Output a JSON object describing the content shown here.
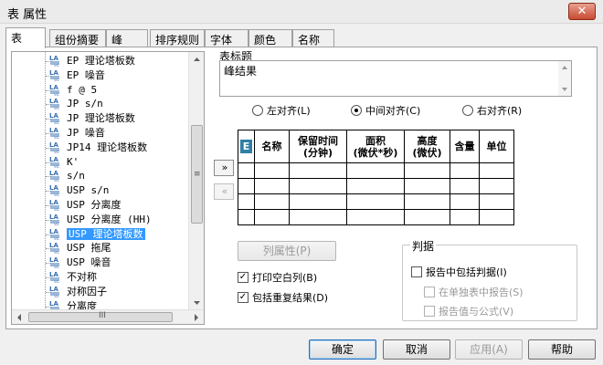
{
  "window": {
    "title": "表 属性",
    "close_glyph": "✕"
  },
  "tabs": [
    {
      "label": "表",
      "active": true
    },
    {
      "label": "组份摘要"
    },
    {
      "label": "峰"
    },
    {
      "label": "排序规则"
    },
    {
      "label": "字体"
    },
    {
      "label": "颜色"
    },
    {
      "label": "名称"
    }
  ],
  "tree": {
    "items": [
      "EP 理论塔板数",
      "EP 噪音",
      "f @ 5",
      "JP s/n",
      "JP 理论塔板数",
      "JP 噪音",
      "JP14 理论塔板数",
      "K'",
      "s/n",
      "USP s/n",
      "USP 分离度",
      "USP 分离度 (HH)",
      "USP 理论塔板数",
      "USP 拖尾",
      "USP 噪音",
      "不对称",
      "对称因子",
      "分离度"
    ],
    "selected_index": 12,
    "vscroll_grip": "≡",
    "hscroll_grip": "III"
  },
  "title_group": {
    "legend": "表标题",
    "value": "峰结果"
  },
  "alignment": {
    "options": [
      "左对齐(L)",
      "中间对齐(C)",
      "右对齐(R)"
    ],
    "selected_index": 1
  },
  "columns": {
    "icon": "E",
    "headers": [
      "名称",
      "保留时间\n(分钟)",
      "面积\n(微伏*秒)",
      "高度\n(微伏)",
      "含量",
      "单位"
    ],
    "empty_rows": 4
  },
  "move_buttons": {
    "add": "»",
    "remove": "«"
  },
  "column_properties_button": "列属性(P)",
  "options": {
    "print_empty_columns": {
      "label": "打印空白列(B)",
      "checked": true
    },
    "include_duplicate_results": {
      "label": "包括重复结果(D)",
      "checked": true
    }
  },
  "judgment": {
    "legend": "判据",
    "include": {
      "label": "报告中包括判据(I)",
      "checked": false
    },
    "separate_table": {
      "label": "在单独表中报告(S)",
      "checked": false
    },
    "report_value_formula": {
      "label": "报告值与公式(V)",
      "checked": false
    }
  },
  "footer": {
    "ok": "确定",
    "cancel": "取消",
    "apply": "应用(A)",
    "help": "帮助"
  }
}
